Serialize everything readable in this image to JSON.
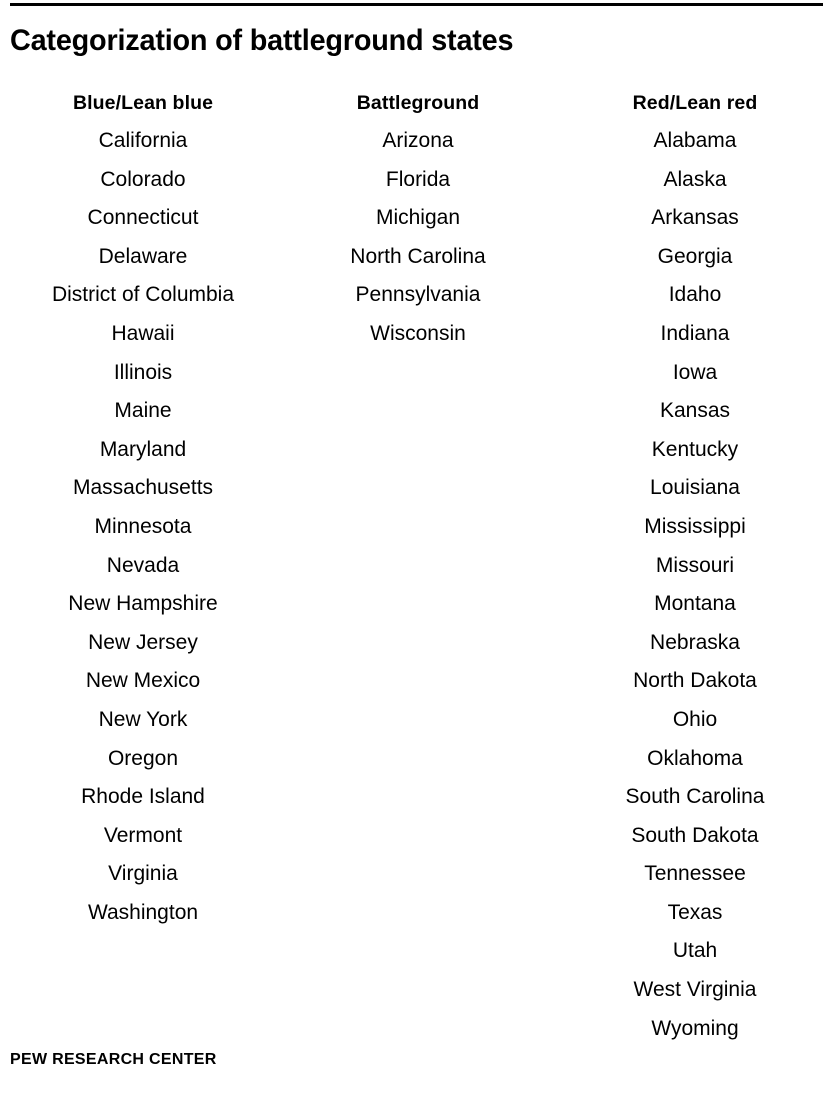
{
  "title": "Categorization of battleground states",
  "source": "PEW RESEARCH CENTER",
  "columns": [
    {
      "header": "Blue/Lean blue",
      "items": [
        "California",
        "Colorado",
        "Connecticut",
        "Delaware",
        "District of Columbia",
        "Hawaii",
        "Illinois",
        "Maine",
        "Maryland",
        "Massachusetts",
        "Minnesota",
        "Nevada",
        "New Hampshire",
        "New Jersey",
        "New Mexico",
        "New York",
        "Oregon",
        "Rhode Island",
        "Vermont",
        "Virginia",
        "Washington"
      ]
    },
    {
      "header": "Battleground",
      "items": [
        "Arizona",
        "Florida",
        "Michigan",
        "North Carolina",
        "Pennsylvania",
        "Wisconsin"
      ]
    },
    {
      "header": "Red/Lean red",
      "items": [
        "Alabama",
        "Alaska",
        "Arkansas",
        "Georgia",
        "Idaho",
        "Indiana",
        "Iowa",
        "Kansas",
        "Kentucky",
        "Louisiana",
        "Mississippi",
        "Missouri",
        "Montana",
        "Nebraska",
        "North Dakota",
        "Ohio",
        "Oklahoma",
        "South Carolina",
        "South Dakota",
        "Tennessee",
        "Texas",
        "Utah",
        "West Virginia",
        "Wyoming"
      ]
    }
  ],
  "chart_data": {
    "type": "table",
    "title": "Categorization of battleground states",
    "columns": [
      "Blue/Lean blue",
      "Battleground",
      "Red/Lean red"
    ],
    "rows": [
      [
        "California",
        "Arizona",
        "Alabama"
      ],
      [
        "Colorado",
        "Florida",
        "Alaska"
      ],
      [
        "Connecticut",
        "Michigan",
        "Arkansas"
      ],
      [
        "Delaware",
        "North Carolina",
        "Georgia"
      ],
      [
        "District of Columbia",
        "Pennsylvania",
        "Idaho"
      ],
      [
        "Hawaii",
        "Wisconsin",
        "Indiana"
      ],
      [
        "Illinois",
        "",
        "Iowa"
      ],
      [
        "Maine",
        "",
        "Kansas"
      ],
      [
        "Maryland",
        "",
        "Kentucky"
      ],
      [
        "Massachusetts",
        "",
        "Louisiana"
      ],
      [
        "Minnesota",
        "",
        "Mississippi"
      ],
      [
        "Nevada",
        "",
        "Missouri"
      ],
      [
        "New Hampshire",
        "",
        "Montana"
      ],
      [
        "New Jersey",
        "",
        "Nebraska"
      ],
      [
        "New Mexico",
        "",
        "North Dakota"
      ],
      [
        "New York",
        "",
        "Ohio"
      ],
      [
        "Oregon",
        "",
        "Oklahoma"
      ],
      [
        "Rhode Island",
        "",
        "South Carolina"
      ],
      [
        "Vermont",
        "",
        "South Dakota"
      ],
      [
        "Virginia",
        "",
        "Tennessee"
      ],
      [
        "Washington",
        "",
        "Texas"
      ],
      [
        "",
        "",
        "Utah"
      ],
      [
        "",
        "",
        "West Virginia"
      ],
      [
        "",
        "",
        "Wyoming"
      ]
    ],
    "counts": {
      "Blue/Lean blue": 21,
      "Battleground": 6,
      "Red/Lean red": 24
    },
    "source": "PEW RESEARCH CENTER"
  }
}
